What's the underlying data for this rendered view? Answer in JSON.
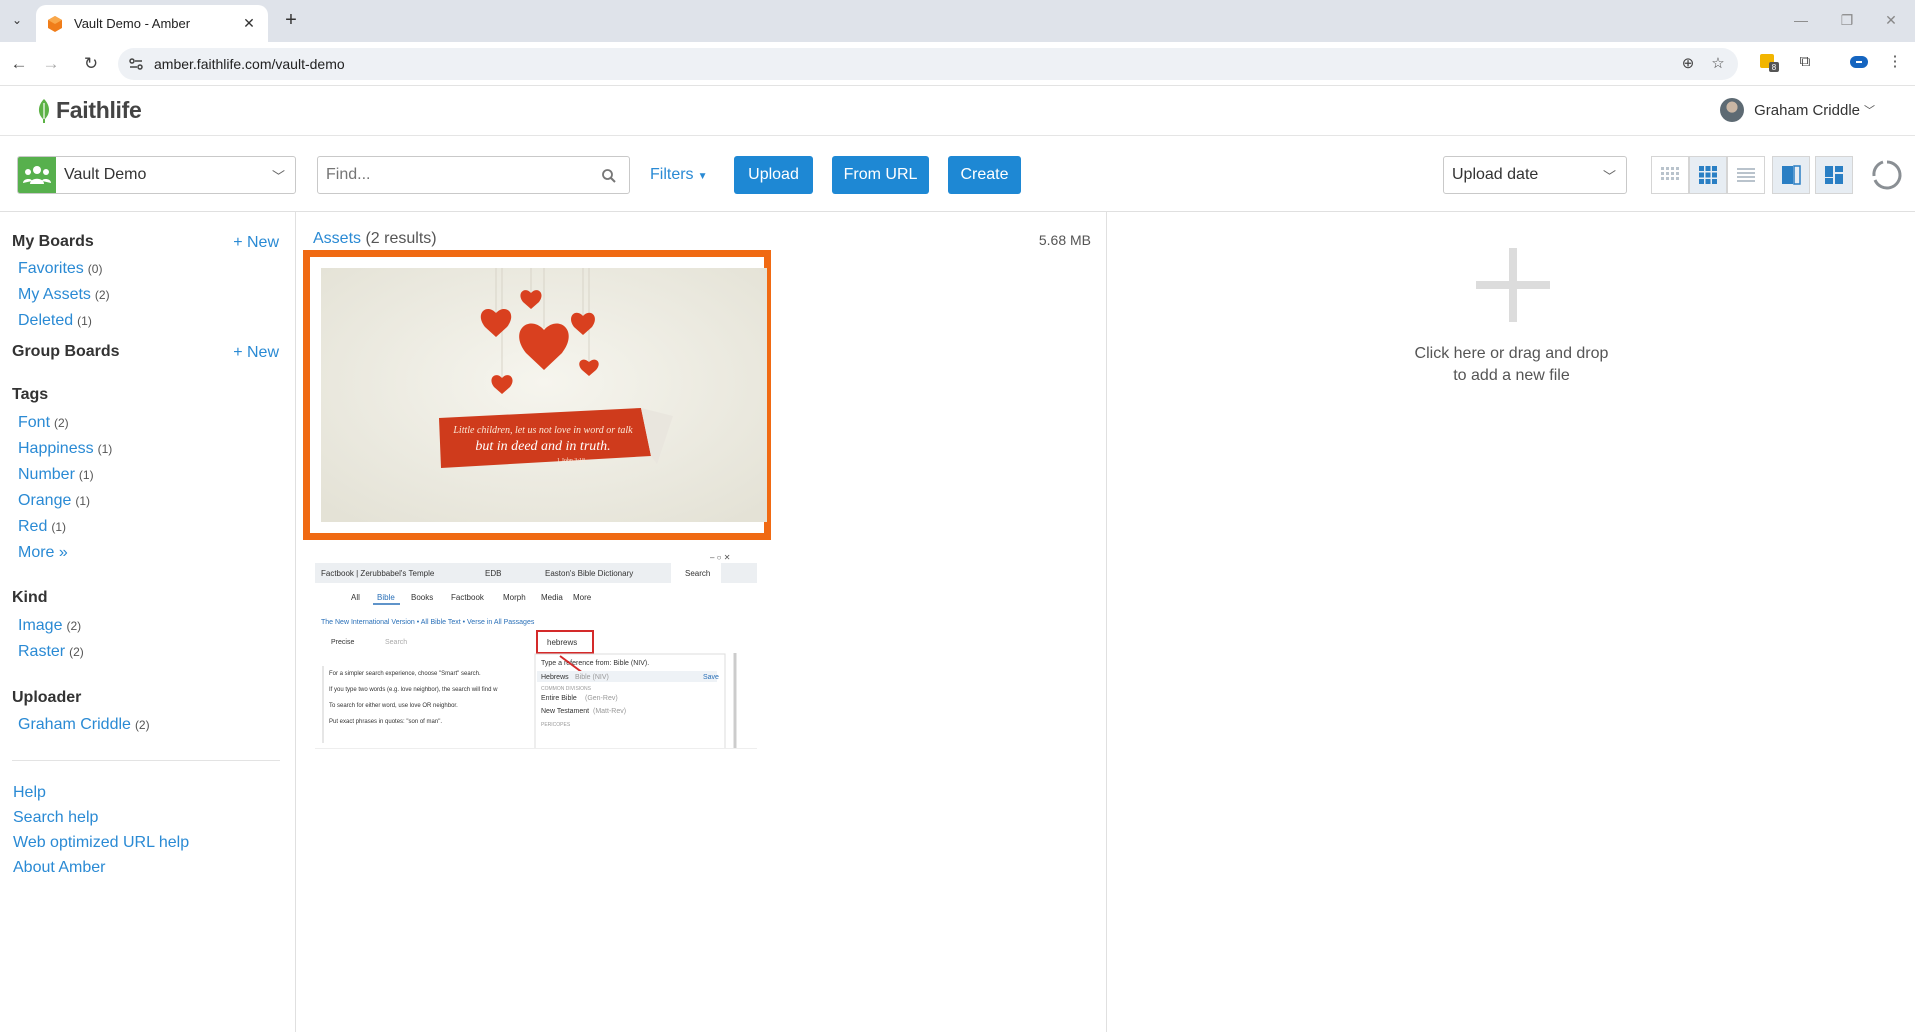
{
  "browser": {
    "tab_title": "Vault Demo - Amber",
    "url": "amber.faithlife.com/vault-demo",
    "extension_badge": "8"
  },
  "header": {
    "logo_text": "Faithlife",
    "user_name": "Graham Criddle"
  },
  "actionbar": {
    "vault_name": "Vault Demo",
    "find_placeholder": "Find...",
    "filters_label": "Filters",
    "upload_label": "Upload",
    "from_url_label": "From URL",
    "create_label": "Create",
    "sort_value": "Upload date"
  },
  "sidebar": {
    "my_boards": {
      "title": "My Boards",
      "new_label": "+ New",
      "items": [
        {
          "label": "Favorites",
          "count": "(0)"
        },
        {
          "label": "My Assets",
          "count": "(2)"
        },
        {
          "label": "Deleted",
          "count": "(1)"
        }
      ]
    },
    "group_boards": {
      "title": "Group Boards",
      "new_label": "+ New"
    },
    "tags": {
      "title": "Tags",
      "items": [
        {
          "label": "Font",
          "count": "(2)"
        },
        {
          "label": "Happiness",
          "count": "(1)"
        },
        {
          "label": "Number",
          "count": "(1)"
        },
        {
          "label": "Orange",
          "count": "(1)"
        },
        {
          "label": "Red",
          "count": "(1)"
        }
      ],
      "more_label": "More »"
    },
    "kind": {
      "title": "Kind",
      "items": [
        {
          "label": "Image",
          "count": "(2)"
        },
        {
          "label": "Raster",
          "count": "(2)"
        }
      ]
    },
    "uploader": {
      "title": "Uploader",
      "items": [
        {
          "label": "Graham Criddle",
          "count": "(2)"
        }
      ]
    },
    "help_links": [
      "Help",
      "Search help",
      "Web optimized URL help",
      "About Amber"
    ]
  },
  "main": {
    "results_link": "Assets",
    "results_count": "(2 results)",
    "total_size": "5.68 MB",
    "asset1_text": {
      "line1": "Little children, let us not love in word or talk",
      "line2": "but in deed and in truth.",
      "ref": "1 John 3:18"
    },
    "asset2_text": {
      "tabs": [
        "Factbook | Zerubbabel's Temple",
        "EDB",
        "Easton's Bible Dictionary",
        "Search"
      ],
      "nav": [
        "All",
        "Bible",
        "Books",
        "Factbook",
        "Morph",
        "Media",
        "More"
      ],
      "crumb": "The New International Version • All Bible Text • Verse in All Passages",
      "precise": "Precise",
      "search_placeholder": "Search",
      "query": "hebrews",
      "hint": "Type a reference from: Bible (NIV).",
      "suggest1": "Hebrews",
      "suggest1_sub": "Bible (NIV)",
      "save": "Save",
      "section": "COMMON DIVISIONS",
      "suggest2": "Entire Bible",
      "suggest2_sub": "(Gen-Rev)",
      "suggest3": "New Testament",
      "suggest3_sub": "(Matt-Rev)",
      "section2": "PERICOPES",
      "help1": "For a simpler search experience, choose \"Smart\" search.",
      "help2": "If you type two words (e.g. love neighbor), the search will find w",
      "help3": "To search for either word, use love OR neighbor.",
      "help4": "Put exact phrases in quotes: \"son of man\"."
    }
  },
  "dropzone": {
    "line1": "Click here or drag and drop",
    "line2": "to add a new file"
  },
  "colors": {
    "accent": "#1e88d4",
    "link": "#2a8ad4",
    "selection": "#f06a13",
    "group_green": "#57b04d"
  }
}
